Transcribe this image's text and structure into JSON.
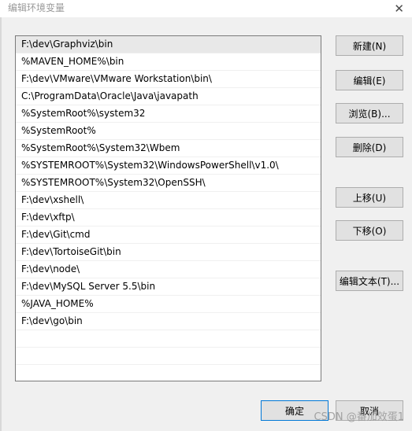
{
  "window": {
    "title": "编辑环境变量",
    "close_glyph": "✕"
  },
  "paths": [
    "F:\\dev\\Graphviz\\bin",
    "%MAVEN_HOME%\\bin",
    "F:\\dev\\VMware\\VMware Workstation\\bin\\",
    "C:\\ProgramData\\Oracle\\Java\\javapath",
    "%SystemRoot%\\system32",
    "%SystemRoot%",
    "%SystemRoot%\\System32\\Wbem",
    "%SYSTEMROOT%\\System32\\WindowsPowerShell\\v1.0\\",
    "%SYSTEMROOT%\\System32\\OpenSSH\\",
    "F:\\dev\\xshell\\",
    "F:\\dev\\xftp\\",
    "F:\\dev\\Git\\cmd",
    "F:\\dev\\TortoiseGit\\bin",
    "F:\\dev\\node\\",
    "F:\\dev\\MySQL Server 5.5\\bin",
    "%JAVA_HOME%",
    "F:\\dev\\go\\bin"
  ],
  "buttons": {
    "new": "新建(N)",
    "edit": "编辑(E)",
    "browse": "浏览(B)...",
    "delete": "删除(D)",
    "move_up": "上移(U)",
    "move_down": "下移(O)",
    "edit_text": "编辑文本(T)...",
    "ok": "确定",
    "cancel": "取消"
  },
  "watermark": "CSDN @番加效蛋1"
}
